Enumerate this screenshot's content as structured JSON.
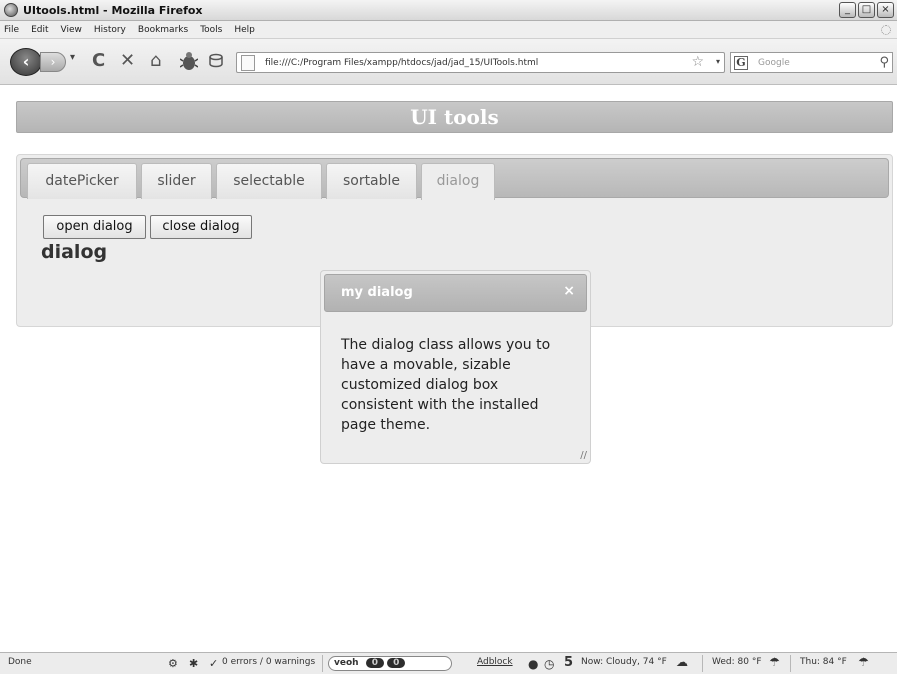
{
  "window": {
    "title": "UItools.html - Mozilla Firefox",
    "minimize": "_",
    "maximize": "□",
    "close": "×"
  },
  "menu": [
    "File",
    "Edit",
    "View",
    "History",
    "Bookmarks",
    "Tools",
    "Help"
  ],
  "navbar": {
    "back": "‹",
    "forward": "›",
    "dropdown": "▾",
    "reload": "C",
    "stop": "✕",
    "home": "⌂",
    "url": "file:///C:/Program Files/xampp/htdocs/jad/jad_15/UITools.html",
    "star": "☆",
    "url_dropdown": "▾",
    "search_engine": "G",
    "search_placeholder": "Google",
    "search_go": "⚲"
  },
  "page": {
    "header": "UI tools",
    "tabs": [
      "datePicker",
      "slider",
      "selectable",
      "sortable",
      "dialog"
    ],
    "active_tab": "dialog",
    "panel_title": "dialog",
    "open_button": "open dialog",
    "close_button": "close dialog"
  },
  "dialog": {
    "title": "my dialog",
    "close": "×",
    "body": "The dialog class allows you to have a movable, sizable customized dialog box consistent with the installed page theme.",
    "resize": "//"
  },
  "status": {
    "text": "Done",
    "errors": "0 errors / 0 warnings",
    "veoh": "veoh",
    "veoh_count1": "0",
    "veoh_count2": "0",
    "adblock": "Adblock",
    "counter": "5",
    "weather_now": "Now: Cloudy, 74 °F",
    "weather_wed": "Wed: 80 °F",
    "weather_thu": "Thu: 84 °F"
  },
  "colors": {
    "header_bar": "#bdbdbd",
    "widget_bg": "#ededed",
    "dialog_title_bg": "#bcbcbc"
  }
}
